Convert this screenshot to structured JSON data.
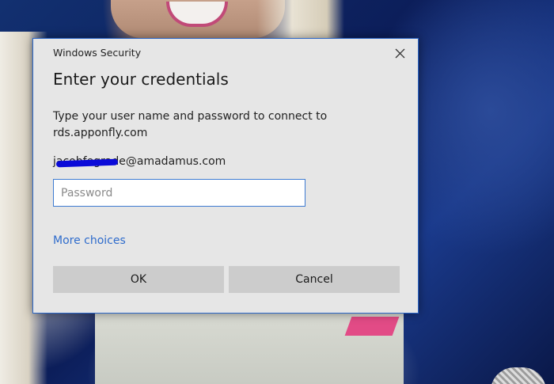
{
  "window": {
    "title": "Windows Security"
  },
  "dialog": {
    "heading": "Enter your credentials",
    "instructions": "Type your user name and password to connect to rds.apponfly.com",
    "username": "jacobfegrade@amadamus.com",
    "password": {
      "value": "",
      "placeholder": "Password"
    },
    "more_choices_label": "More choices",
    "ok_label": "OK",
    "cancel_label": "Cancel"
  },
  "icons": {
    "close": "close-icon"
  },
  "colors": {
    "accent": "#2b66c7",
    "link": "#2f6ccc",
    "dialog_bg": "#e6e6e6",
    "button_bg": "#cccccc",
    "redaction": "#0a0ad8"
  }
}
